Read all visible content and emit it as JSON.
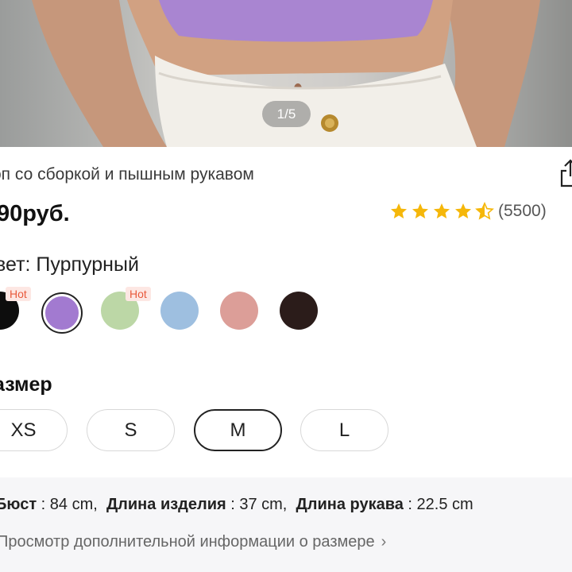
{
  "gallery": {
    "counter": "1/5"
  },
  "product": {
    "title": "оп со сборкой и пышным рукавом",
    "price": "90руб.",
    "rating": 4.5,
    "rating_count": "(5500)"
  },
  "color": {
    "label": "вет: Пурпурный",
    "swatches": [
      {
        "name": "black",
        "color": "#0d0d0d",
        "badge": "Hot"
      },
      {
        "name": "purple",
        "color": "#a27ad0",
        "selected": true
      },
      {
        "name": "green",
        "color": "#bcd7a6",
        "badge": "Hot"
      },
      {
        "name": "blue",
        "color": "#9ebfe0"
      },
      {
        "name": "pink",
        "color": "#dc9e98"
      },
      {
        "name": "brown",
        "color": "#2b1c1a"
      }
    ]
  },
  "size": {
    "label": "азмер",
    "options": [
      "XS",
      "S",
      "M",
      "L"
    ],
    "selected": "M"
  },
  "measurements": {
    "bust_label": "Бюст",
    "bust_value": "84 cm,",
    "length_label": "Длина изделия",
    "length_value": "37 cm,",
    "sleeve_label": "Длина рукава",
    "sleeve_value": "22.5 cm"
  },
  "more_info": "Просмотр дополнительной информации о размере"
}
